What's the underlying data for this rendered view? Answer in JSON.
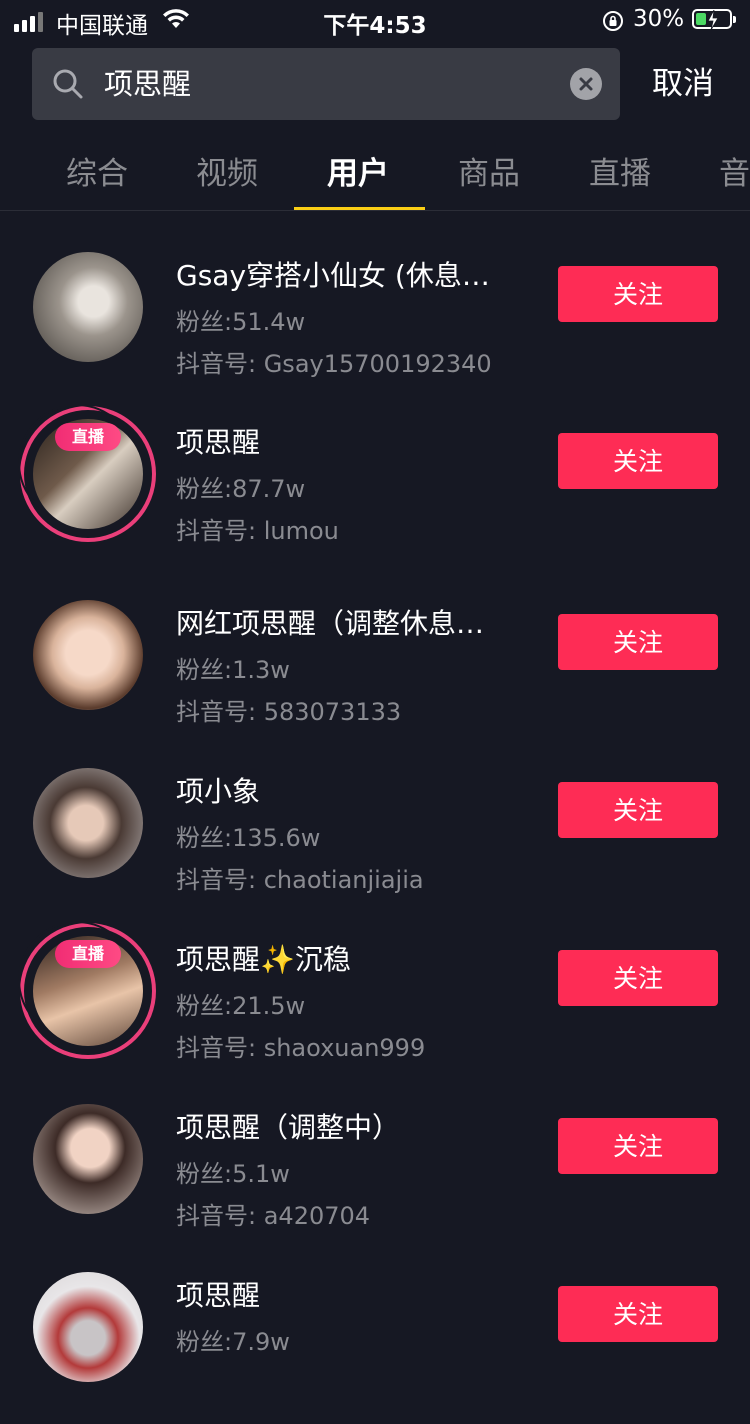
{
  "status_bar": {
    "carrier": "中国联通",
    "time": "下午4:53",
    "battery": "30%",
    "battery_level": 0.3
  },
  "search": {
    "query": "项思醒",
    "cancel_label": "取消"
  },
  "tabs": [
    {
      "label": "综合"
    },
    {
      "label": "视频"
    },
    {
      "label": "用户",
      "active": true
    },
    {
      "label": "商品"
    },
    {
      "label": "直播"
    },
    {
      "label": "音"
    }
  ],
  "follow_label": "关注",
  "users": [
    {
      "name": " Gsay穿搭小仙女 (休息…",
      "fans": "粉丝:51.4w",
      "douyin_id": "抖音号: Gsay15700192340",
      "live": false
    },
    {
      "name": "项思醒",
      "fans": "粉丝:87.7w",
      "douyin_id": "抖音号: lumou",
      "live": true,
      "live_label": "直播"
    },
    {
      "name": "网红项思醒（调整休息…",
      "fans": "粉丝:1.3w",
      "douyin_id": "抖音号: 583073133",
      "live": false
    },
    {
      "name": "项小象",
      "fans": "粉丝:135.6w",
      "douyin_id": "抖音号: chaotianjiajia",
      "live": false
    },
    {
      "name": "项思醒✨沉稳",
      "fans": "粉丝:21.5w",
      "douyin_id": "抖音号: shaoxuan999",
      "live": true,
      "live_label": "直播"
    },
    {
      "name": "项思醒（调整中）",
      "fans": "粉丝:5.1w",
      "douyin_id": "抖音号: a420704",
      "live": false
    },
    {
      "name": "项思醒",
      "fans": "粉丝:7.9w",
      "douyin_id": "",
      "live": false
    }
  ],
  "colors": {
    "background": "#161823",
    "follow_button": "#fe2c55",
    "tab_indicator": "#face15",
    "live_ring": "#ea3f7a"
  }
}
